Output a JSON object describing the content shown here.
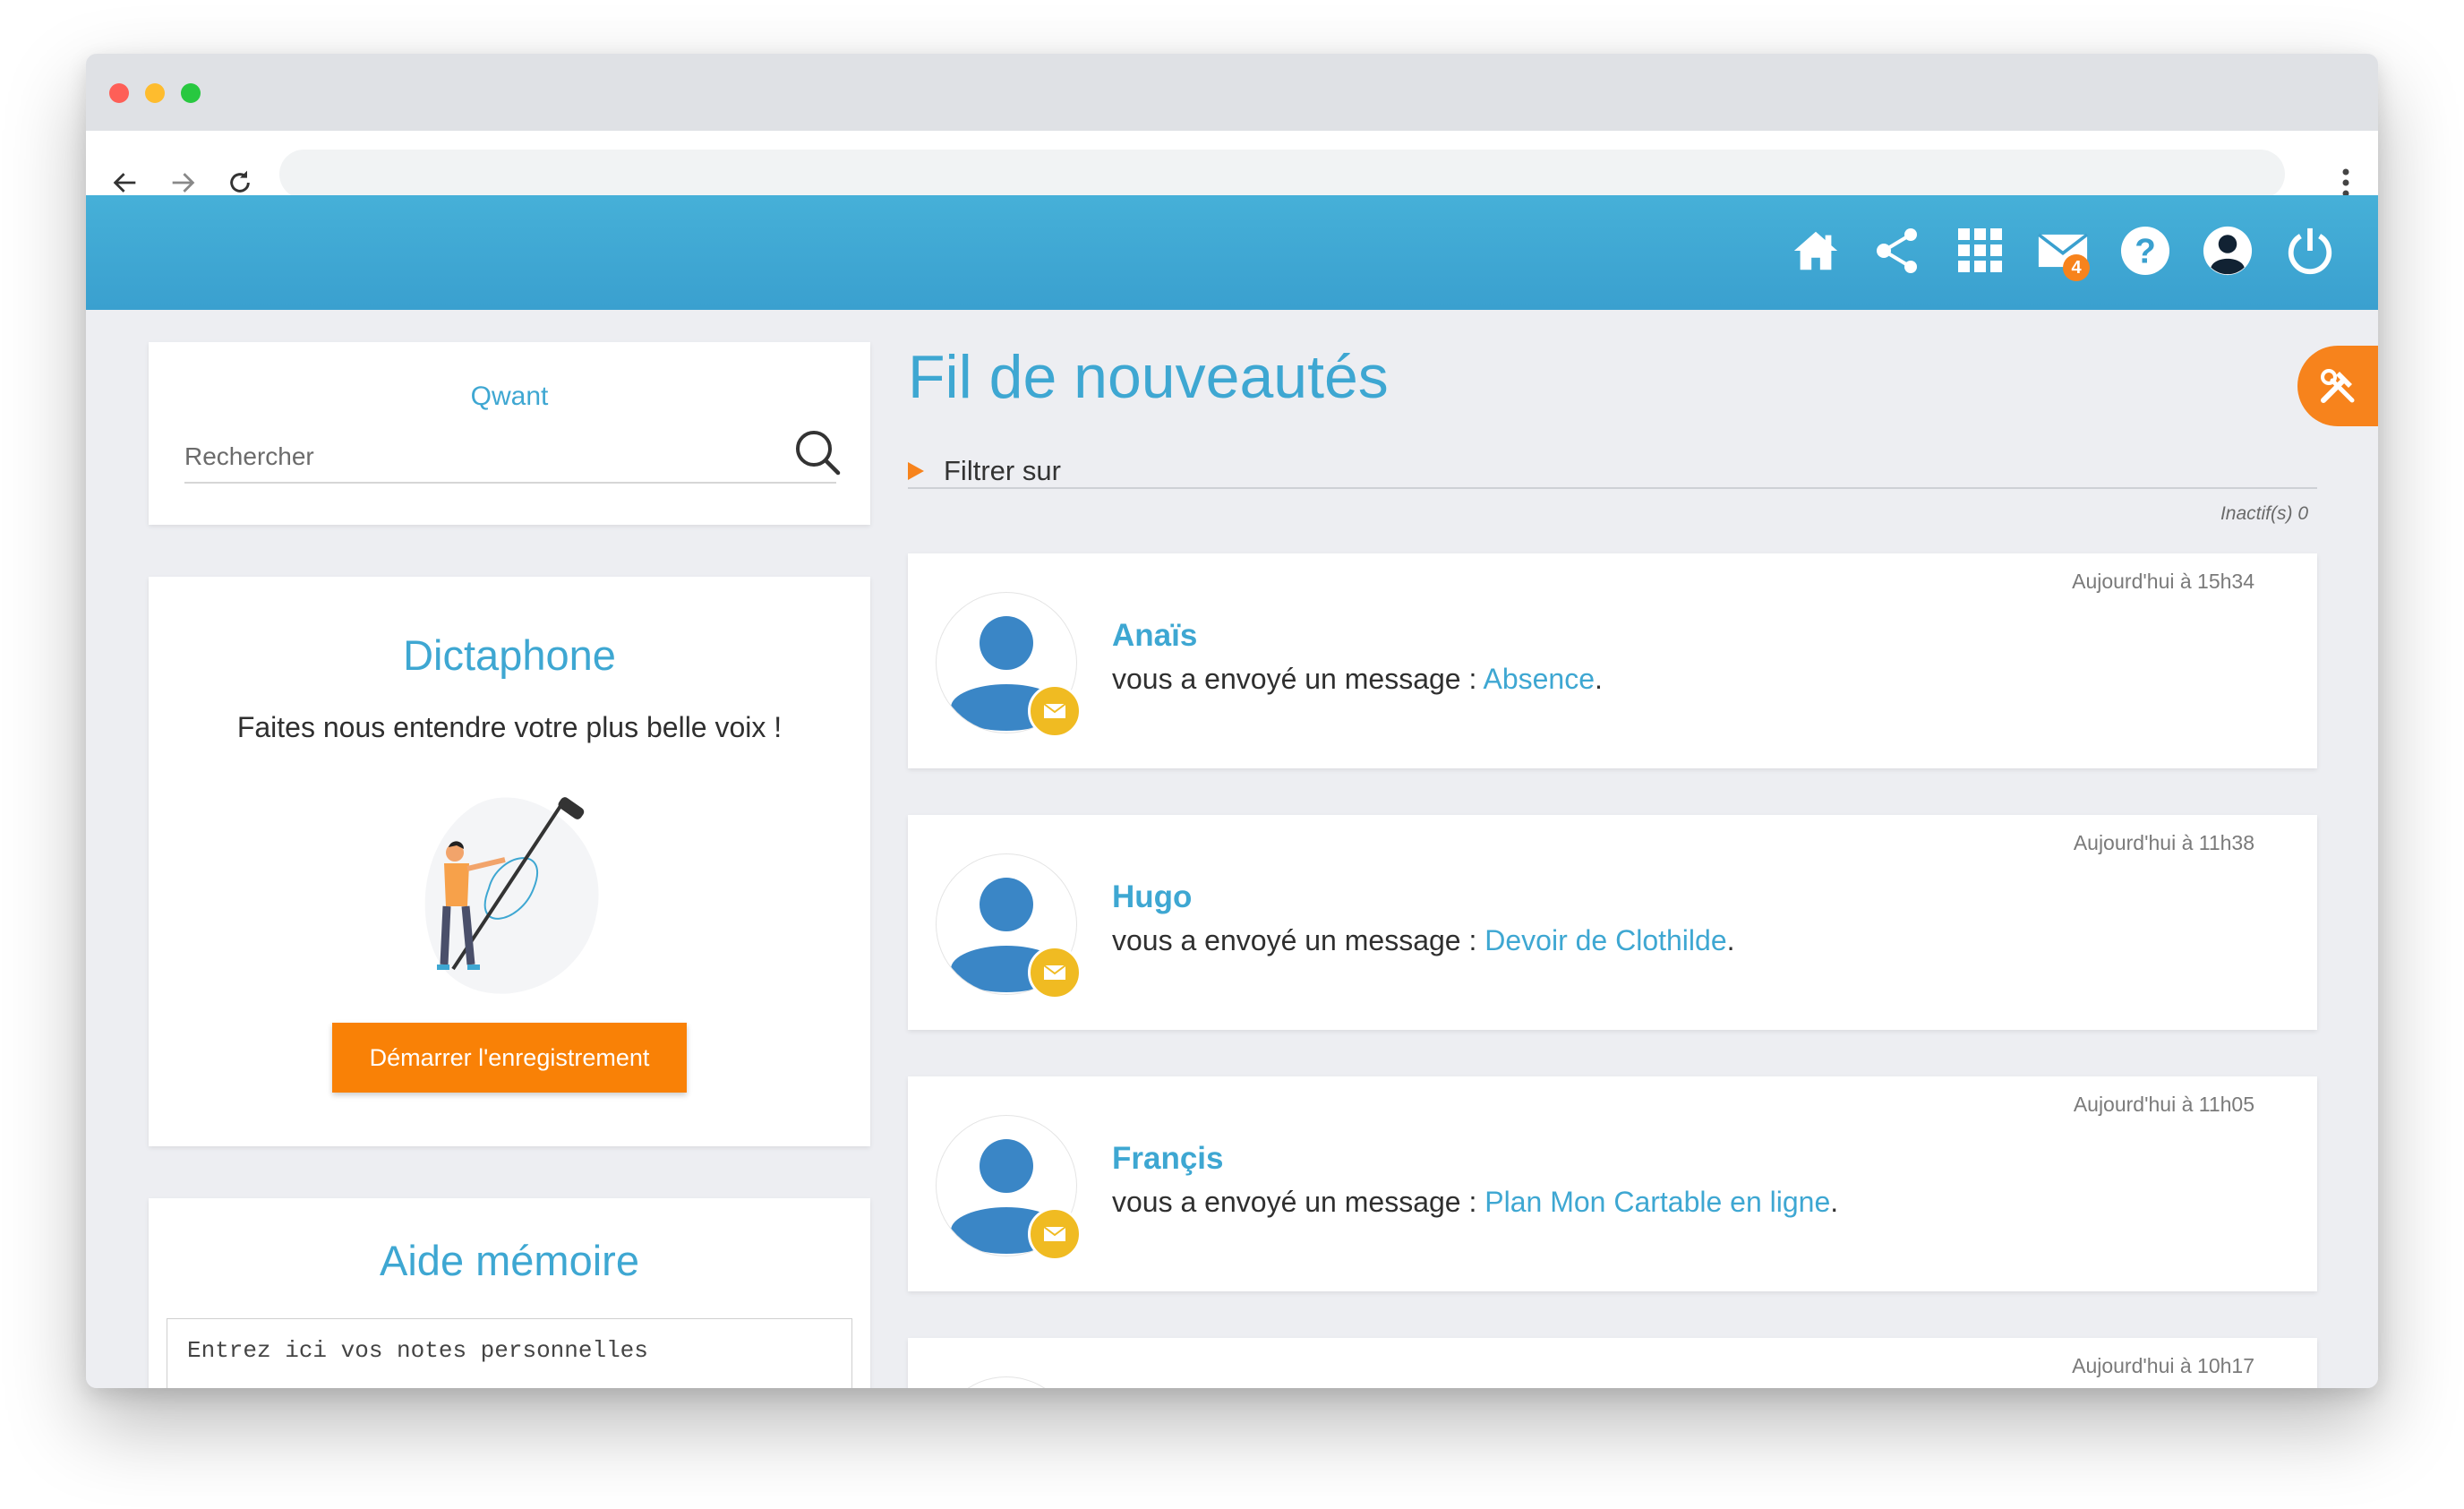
{
  "search": {
    "title": "Qwant",
    "placeholder": "Rechercher"
  },
  "dictaphone": {
    "title": "Dictaphone",
    "subtitle": "Faites nous entendre votre plus belle voix !",
    "button_label": "Démarrer l'enregistrement"
  },
  "memo": {
    "title": "Aide mémoire",
    "placeholder": "Entrez ici vos notes personnelles"
  },
  "header": {
    "icons": [
      "home-icon",
      "share-icon",
      "apps-grid-icon",
      "mail-icon",
      "help-icon",
      "user-account-icon",
      "power-icon"
    ],
    "mail_badge": "4",
    "header_color": "#3ea7d2"
  },
  "feed": {
    "title": "Fil de nouveautés",
    "filter_label": "Filtrer sur",
    "inactive_label": "Inactif(s) 0",
    "items": [
      {
        "time": "Aujourd'hui à 15h34",
        "name": "Anaïs",
        "text": "vous a envoyé un message : ",
        "link": "Absence",
        "suffix": "."
      },
      {
        "time": "Aujourd'hui à 11h38",
        "name": "Hugo",
        "text": "vous a envoyé un message : ",
        "link": "Devoir de Clothilde",
        "suffix": "."
      },
      {
        "time": "Aujourd'hui à 11h05",
        "name": "Françis",
        "text": "vous a envoyé un message : ",
        "link": "Plan Mon Cartable en ligne",
        "suffix": "."
      },
      {
        "time": "Aujourd'hui à 10h17"
      }
    ]
  },
  "colors": {
    "accent_blue": "#3ea7d2",
    "accent_orange": "#f7831c",
    "badge_yellow": "#f0bb22"
  }
}
